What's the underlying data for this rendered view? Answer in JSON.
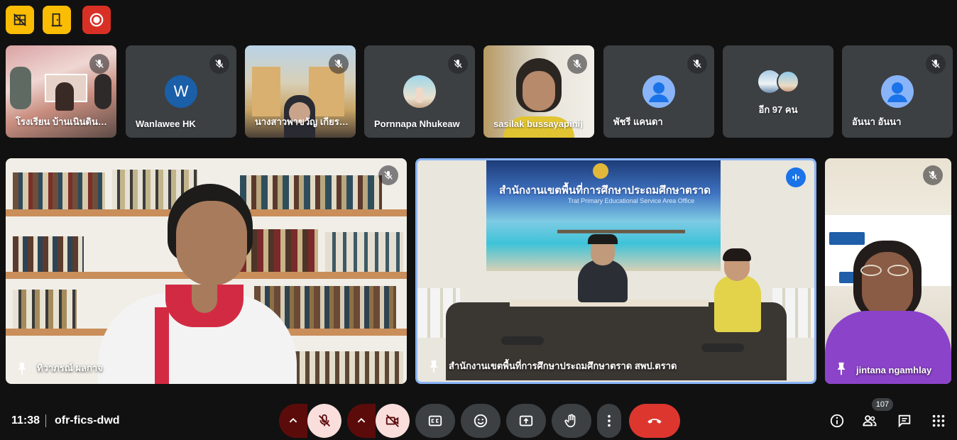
{
  "host_badges": [
    {
      "icon": "grid-off-icon",
      "color": "#fbbc04"
    },
    {
      "icon": "door-icon",
      "color": "#fbbc04"
    },
    {
      "icon": "record-icon",
      "color": "#d93025"
    }
  ],
  "filmstrip": [
    {
      "name": "โรงเรียน บ้านเนินดินแดง",
      "type": "video"
    },
    {
      "name": "Wanlawee HK",
      "type": "initial",
      "initial": "W",
      "avatar_color": "#1a5fa8"
    },
    {
      "name": "นางสาวพาขวัญ เกียรติศักดิ์",
      "type": "video"
    },
    {
      "name": "Pornnapa Nhukeaw",
      "type": "photo"
    },
    {
      "name": "sasilak bussayapinij",
      "type": "video"
    },
    {
      "name": "พัชรี แคนดา",
      "type": "default"
    },
    {
      "name": "อีก 97 คน",
      "type": "more"
    },
    {
      "name": "อันนา อันนา",
      "type": "default"
    }
  ],
  "stage": [
    {
      "name": "ทิวาภรณ์ ผลกาจ"
    },
    {
      "name": "สำนักงานเขตพื้นที่การศึกษาประถมศึกษาตราด สพป.ตราด",
      "banner_title": "สำนักงานเขตพื้นที่การศึกษาประถมศึกษาตราด",
      "banner_sub": "Trat Primary Educational Service Area Office"
    },
    {
      "name": "jintana ngamhlay"
    }
  ],
  "meeting": {
    "time": "11:38",
    "code": "ofr-fics-dwd",
    "participants": "107"
  },
  "colors": {
    "accent": "#8ab4f8",
    "end_call": "#dc362e",
    "mic_off_bg": "#f9dedc"
  }
}
